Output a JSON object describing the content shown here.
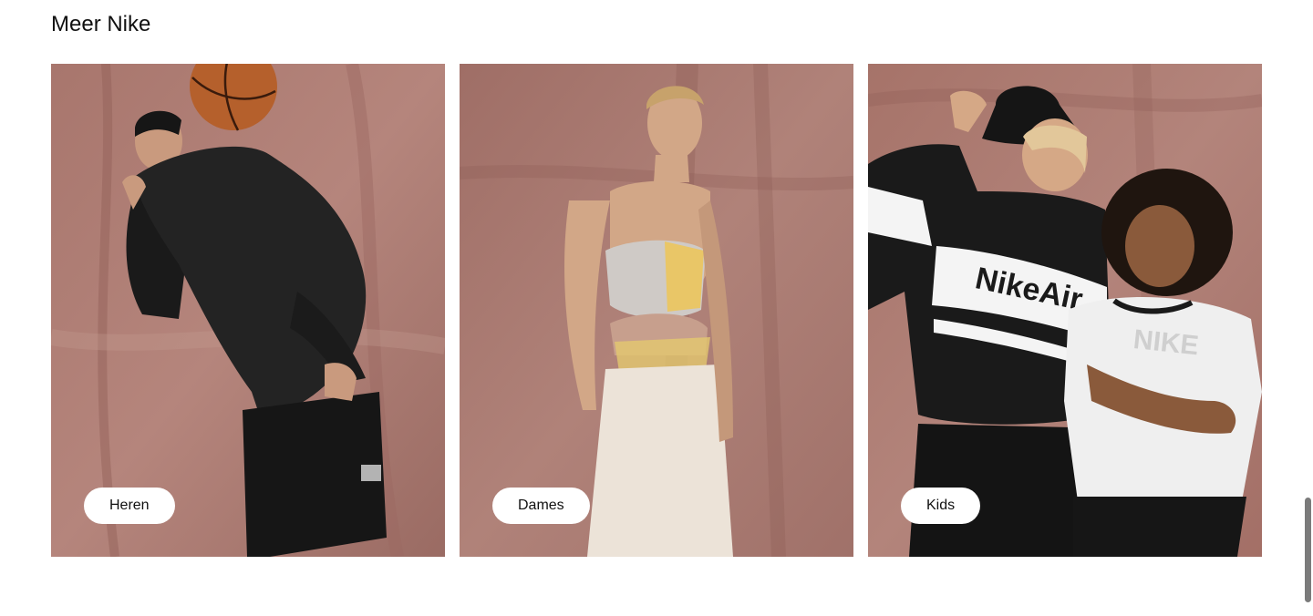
{
  "section": {
    "title": "Meer Nike"
  },
  "cards": [
    {
      "label": "Heren"
    },
    {
      "label": "Dames"
    },
    {
      "label": "Kids"
    }
  ],
  "prints": {
    "jacket_text": "NikeAir",
    "tee_text": "NIKE"
  },
  "colors": {
    "backdrop": "#a97a72",
    "pill": "#ffffff",
    "text": "#111111"
  }
}
